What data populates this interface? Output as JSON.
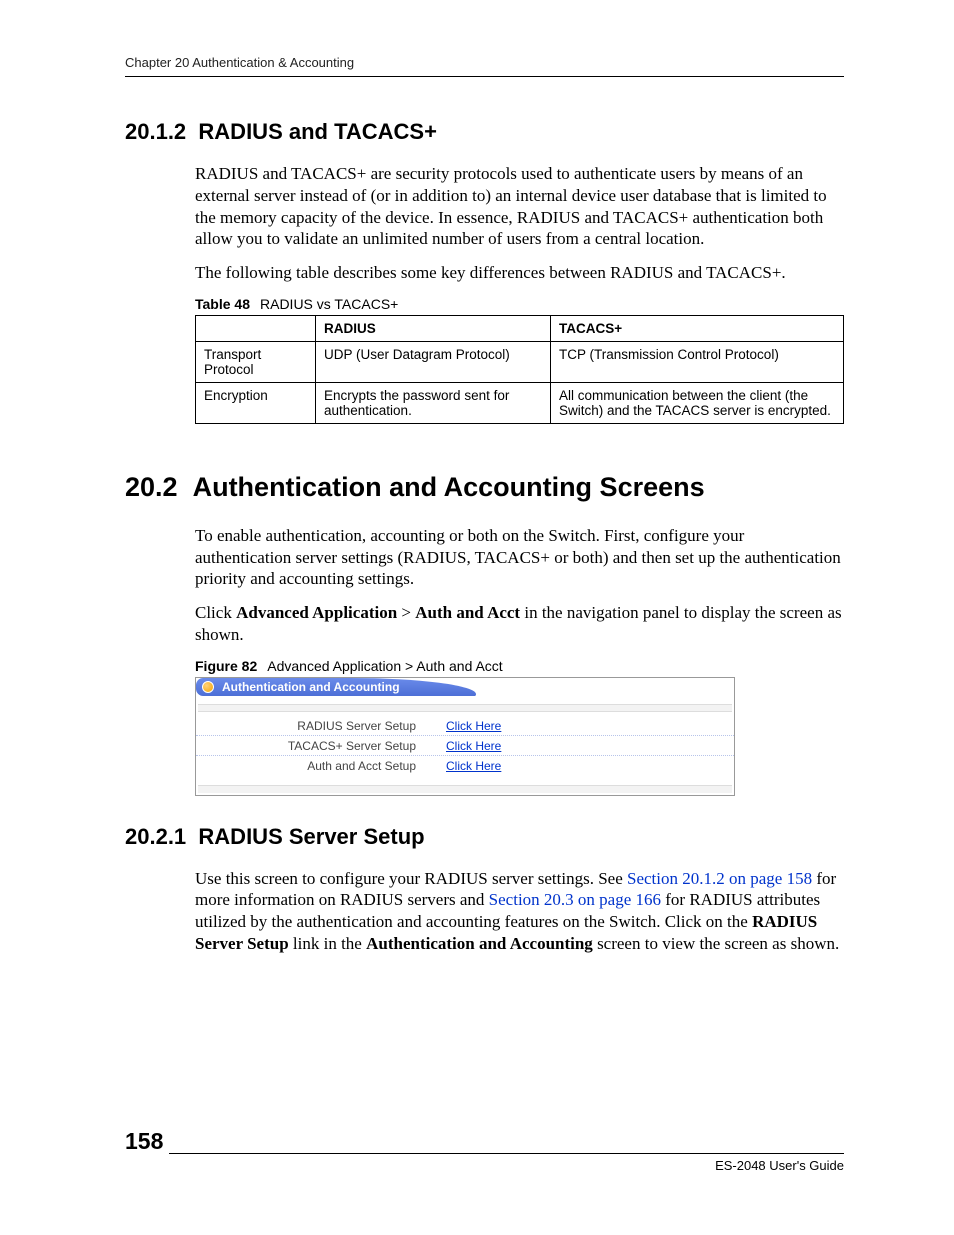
{
  "header": {
    "running": "Chapter 20 Authentication & Accounting"
  },
  "s1": {
    "num": "20.1.2",
    "title": "RADIUS and TACACS+",
    "p1": "RADIUS and TACACS+ are security protocols used to authenticate users by means of an external server instead of (or in addition to) an internal device user database that is limited to the memory capacity of the device. In essence, RADIUS and TACACS+ authentication both allow you to validate an unlimited number of users from a central location.",
    "p2": "The following table describes some key differences between RADIUS and TACACS+."
  },
  "table48": {
    "caption_bold": "Table 48",
    "caption_text": "RADIUS vs TACACS+",
    "headers": [
      "",
      "RADIUS",
      "TACACS+"
    ],
    "rows": [
      [
        "Transport Protocol",
        "UDP (User Datagram Protocol)",
        "TCP (Transmission Control Protocol)"
      ],
      [
        "Encryption",
        "Encrypts the password sent for authentication.",
        "All communication between the client (the Switch) and the TACACS server is encrypted."
      ]
    ]
  },
  "s2": {
    "num": "20.2",
    "title": "Authentication and Accounting Screens",
    "p1": "To enable authentication, accounting or both on the Switch. First, configure your authentication server settings (RADIUS, TACACS+ or both) and then set up the authentication priority and accounting settings.",
    "p2_pre": "Click ",
    "p2_b1": "Advanced Application",
    "p2_mid": " > ",
    "p2_b2": "Auth and Acct",
    "p2_post": " in the navigation panel to display the screen as shown."
  },
  "figure82": {
    "caption_bold": "Figure 82",
    "caption_text": "Advanced Application > Auth and Acct",
    "panel_title": "Authentication and Accounting",
    "rows": [
      {
        "label": "RADIUS Server Setup",
        "link": "Click Here"
      },
      {
        "label": "TACACS+ Server Setup",
        "link": "Click Here"
      },
      {
        "label": "Auth and Acct Setup",
        "link": "Click Here"
      }
    ]
  },
  "s3": {
    "num": "20.2.1",
    "title": "RADIUS Server Setup",
    "p1_a": "Use this screen to configure your RADIUS server settings. See ",
    "p1_link1": "Section 20.1.2 on page 158",
    "p1_b": " for more information on RADIUS servers and ",
    "p1_link2": "Section 20.3 on page 166",
    "p1_c": " for RADIUS attributes utilized by the authentication and accounting features on the Switch. Click on the ",
    "p1_bold1": "RADIUS Server Setup",
    "p1_d": " link in the ",
    "p1_bold2": "Authentication and Accounting",
    "p1_e": " screen to view the screen as shown."
  },
  "footer": {
    "page": "158",
    "guide": "ES-2048 User's Guide"
  },
  "chart_data": {
    "type": "table",
    "title": "RADIUS vs TACACS+",
    "columns": [
      "",
      "RADIUS",
      "TACACS+"
    ],
    "rows": [
      {
        "": "Transport Protocol",
        "RADIUS": "UDP (User Datagram Protocol)",
        "TACACS+": "TCP (Transmission Control Protocol)"
      },
      {
        "": "Encryption",
        "RADIUS": "Encrypts the password sent for authentication.",
        "TACACS+": "All communication between the client (the Switch) and the TACACS server is encrypted."
      }
    ]
  }
}
